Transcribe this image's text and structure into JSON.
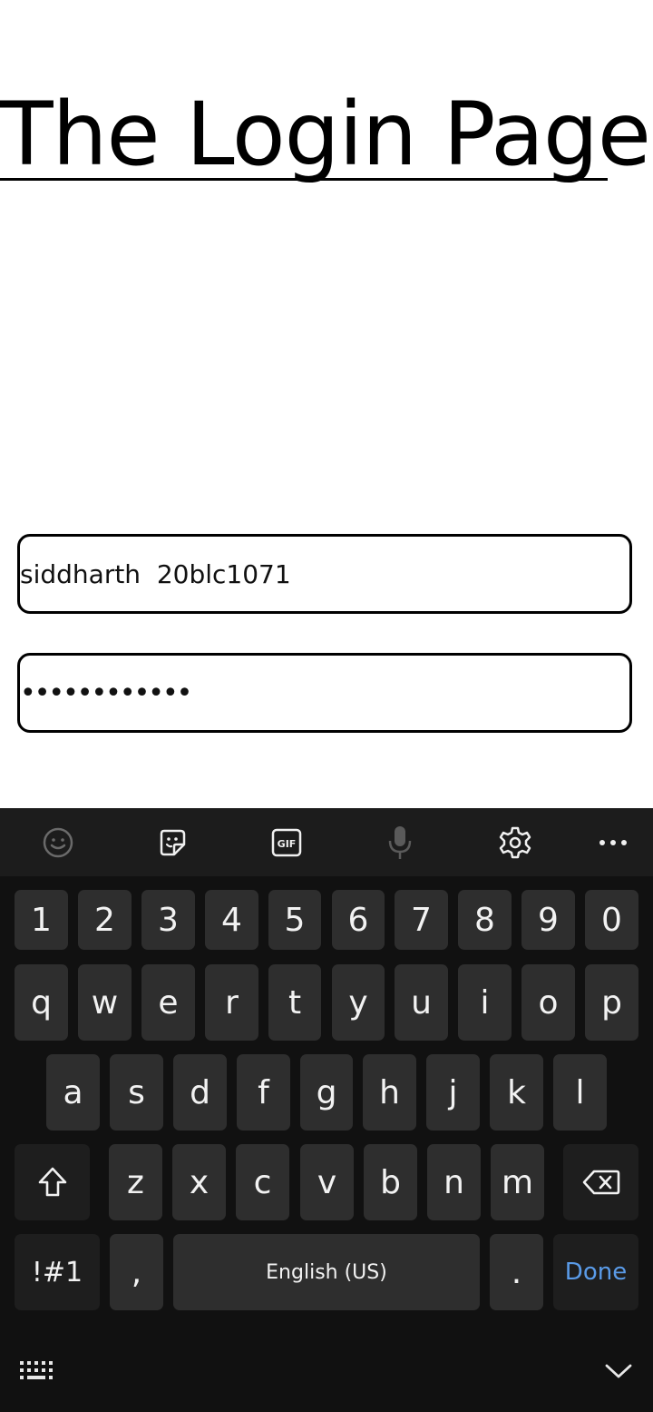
{
  "page": {
    "title": "The Login Page ."
  },
  "form": {
    "username_value": "siddharth  20blc1071",
    "password_value": "••••••••••••"
  },
  "keyboard": {
    "toolbar": [
      "emoji-icon",
      "sticker-icon",
      "gif-icon",
      "microphone-icon",
      "settings-icon",
      "more-icon"
    ],
    "number_row": [
      "1",
      "2",
      "3",
      "4",
      "5",
      "6",
      "7",
      "8",
      "9",
      "0"
    ],
    "row1": [
      "q",
      "w",
      "e",
      "r",
      "t",
      "y",
      "u",
      "i",
      "o",
      "p"
    ],
    "row2": [
      "a",
      "s",
      "d",
      "f",
      "g",
      "h",
      "j",
      "k",
      "l"
    ],
    "row3": [
      "z",
      "x",
      "c",
      "v",
      "b",
      "n",
      "m"
    ],
    "symbols_label": "!#1",
    "comma_label": ",",
    "space_label": "English (US)",
    "period_label": ".",
    "done_label": "Done",
    "done_color": "#5a9be8",
    "key_color": "#2e2e2e",
    "background_color": "#111111"
  }
}
